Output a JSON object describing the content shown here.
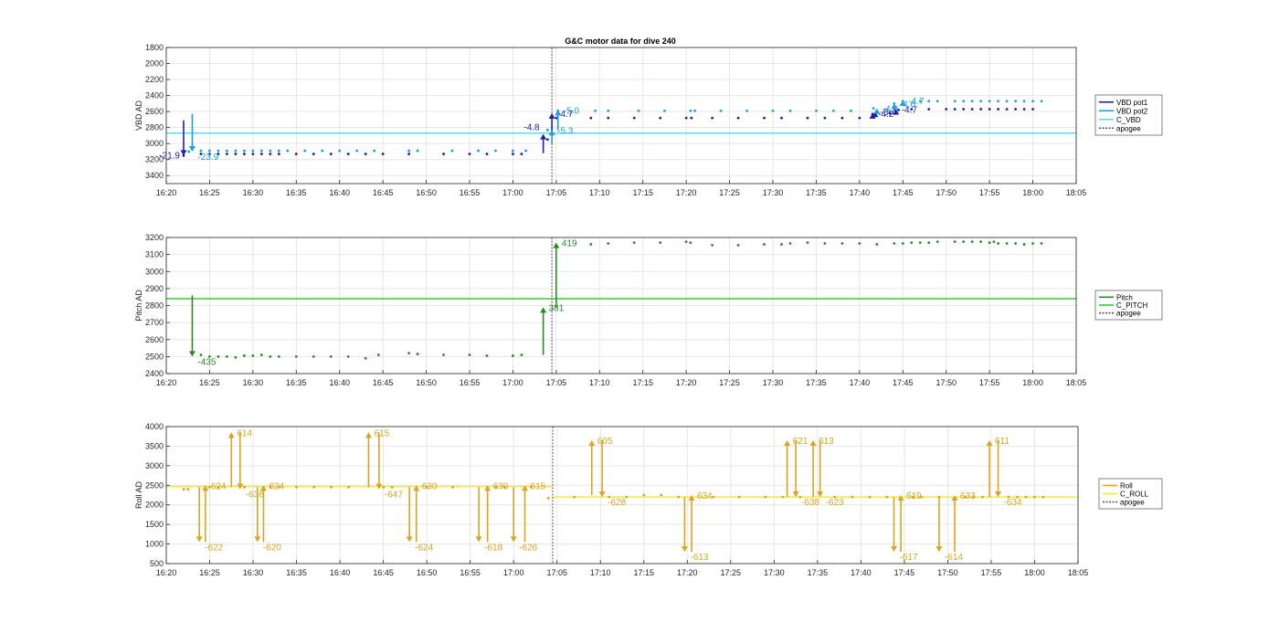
{
  "figure_title": "G&C motor data for dive 240",
  "colors": {
    "vbd_pot1": "#1f1fa8",
    "vbd_pot2": "#1a9fe0",
    "c_vbd": "#5fd8f0",
    "pitch": "#2a8a2a",
    "c_pitch": "#33cc33",
    "roll": "#d9a520",
    "c_roll": "#f5e642",
    "apogee": "#555555",
    "grid": "#e6e6e6",
    "axis": "#262626"
  },
  "chart_data": [
    {
      "type": "scatter",
      "title": "G&C motor data for dive 240",
      "ylabel": "VBD AD",
      "xlabel": "",
      "y_reversed": true,
      "ylim": [
        1800,
        3500
      ],
      "yticks": [
        1800,
        2000,
        2200,
        2400,
        2600,
        2800,
        3000,
        3200,
        3400
      ],
      "xlim": [
        "16:20",
        "18:05"
      ],
      "xticks": [
        "16:20",
        "16:25",
        "16:30",
        "16:35",
        "16:40",
        "16:45",
        "16:50",
        "16:55",
        "17:00",
        "17:05",
        "17:10",
        "17:15",
        "17:20",
        "17:25",
        "17:30",
        "17:35",
        "17:40",
        "17:45",
        "17:50",
        "17:55",
        "18:00",
        "18:05"
      ],
      "grid": true,
      "legend": {
        "position": "right",
        "entries": [
          "VBD pot1",
          "VBD pot2",
          "C_VBD",
          "apogee"
        ]
      },
      "apogee": "17:04.5",
      "reference_lines": [
        {
          "name": "C_VBD",
          "y": 2870
        }
      ],
      "series": [
        {
          "name": "VBD pot1",
          "x": [
            "16:22",
            "16:24",
            "16:25",
            "16:26",
            "16:27",
            "16:28",
            "16:29",
            "16:30",
            "16:31",
            "16:32",
            "16:33",
            "16:35",
            "16:37",
            "16:39",
            "16:41",
            "16:43",
            "16:45",
            "16:48",
            "16:52",
            "16:55",
            "16:57",
            "17:00",
            "17:01",
            "17:04",
            "17:05",
            "17:09",
            "17:11",
            "17:14",
            "17:17",
            "17:20",
            "17:20.6",
            "17:23",
            "17:26",
            "17:29",
            "17:31",
            "17:34",
            "17:36",
            "17:38",
            "17:40",
            "17:41.5",
            "17:43.5",
            "17:44.5",
            "17:46",
            "17:48",
            "17:50",
            "17:51",
            "17:52",
            "17:53",
            "17:54",
            "17:55",
            "17:56",
            "17:57",
            "17:58",
            "17:59",
            "18:00"
          ],
          "y": [
            3150,
            3130,
            3130,
            3130,
            3130,
            3130,
            3130,
            3130,
            3130,
            3130,
            3130,
            3130,
            3130,
            3130,
            3130,
            3130,
            3130,
            3130,
            3130,
            3130,
            3130,
            3130,
            3130,
            2950,
            2680,
            2680,
            2680,
            2680,
            2680,
            2680,
            2680,
            2680,
            2680,
            2680,
            2680,
            2680,
            2680,
            2680,
            2680,
            2630,
            2620,
            2580,
            2570,
            2570,
            2570,
            2570,
            2570,
            2570,
            2570,
            2570,
            2570,
            2570,
            2570,
            2570,
            2570
          ]
        },
        {
          "name": "VBD pot2",
          "x": [
            "16:22.6",
            "16:24",
            "16:25",
            "16:26",
            "16:27",
            "16:28",
            "16:29",
            "16:30",
            "16:31",
            "16:32",
            "16:33",
            "16:34",
            "16:36",
            "16:38",
            "16:40",
            "16:42",
            "16:44",
            "16:48",
            "16:49",
            "16:53",
            "16:56",
            "16:58",
            "17:00",
            "17:01.5",
            "17:04",
            "17:05.2",
            "17:09.5",
            "17:11",
            "17:14.5",
            "17:17.5",
            "17:20.5",
            "17:21",
            "17:24",
            "17:27",
            "17:30",
            "17:32",
            "17:35",
            "17:37",
            "17:39",
            "17:41.6",
            "17:44",
            "17:45",
            "17:47",
            "17:48",
            "17:49",
            "17:51",
            "17:52",
            "17:53",
            "17:54",
            "17:55",
            "17:56",
            "17:57",
            "17:58",
            "17:59",
            "18:00",
            "18:01"
          ],
          "y": [
            3100,
            3090,
            3090,
            3090,
            3090,
            3090,
            3090,
            3090,
            3090,
            3090,
            3090,
            3090,
            3090,
            3090,
            3090,
            3090,
            3090,
            3090,
            3090,
            3090,
            3090,
            3090,
            3090,
            3090,
            2830,
            2590,
            2590,
            2590,
            2590,
            2590,
            2590,
            2590,
            2590,
            2590,
            2590,
            2590,
            2590,
            2590,
            2590,
            2560,
            2500,
            2470,
            2470,
            2470,
            2470,
            2470,
            2470,
            2470,
            2470,
            2470,
            2470,
            2470,
            2470,
            2470,
            2470,
            2470
          ]
        }
      ],
      "annotations": [
        {
          "label": "-21.9",
          "series": "VBD pot1",
          "x": "16:22",
          "from": 2710,
          "to": 3150
        },
        {
          "label": "-23.9",
          "series": "VBD pot2",
          "x": "16:23",
          "from": 2630,
          "to": 3100
        },
        {
          "label": "-4.8",
          "series": "VBD pot1",
          "x": "17:03.5",
          "from": 3120,
          "to": 2880
        },
        {
          "label": "-4.7",
          "series": "VBD pot1",
          "x": "17:04.5",
          "from": 2880,
          "to": 2620
        },
        {
          "label": "-5.3",
          "series": "VBD pot2",
          "x": "17:04.5",
          "from": 3000,
          "to": 2830
        },
        {
          "label": "-5.0",
          "series": "VBD pot2",
          "x": "17:05.2",
          "from": 2830,
          "to": 2580
        },
        {
          "label": "-4.2",
          "series": "VBD pot1",
          "x": "17:41.5",
          "from": 2680,
          "to": 2620
        },
        {
          "label": "-3.4",
          "series": "VBD pot1",
          "x": "17:41.8",
          "from": 2650,
          "to": 2600
        },
        {
          "label": "-4.0",
          "series": "VBD pot2",
          "x": "17:42",
          "from": 2620,
          "to": 2560
        },
        {
          "label": "-4.6",
          "series": "VBD pot2",
          "x": "17:44",
          "from": 2560,
          "to": 2500
        },
        {
          "label": "-4.7",
          "series": "VBD pot2",
          "x": "17:45",
          "from": 2530,
          "to": 2460
        },
        {
          "label": "-4.7",
          "series": "VBD pot1",
          "x": "17:44.2",
          "from": 2620,
          "to": 2570
        }
      ]
    },
    {
      "type": "scatter",
      "title": "",
      "ylabel": "Pitch AD",
      "xlabel": "",
      "ylim": [
        2400,
        3200
      ],
      "yticks": [
        2400,
        2500,
        2600,
        2700,
        2800,
        2900,
        3000,
        3100,
        3200
      ],
      "xlim": [
        "16:20",
        "18:05"
      ],
      "xticks": [
        "16:20",
        "16:25",
        "16:30",
        "16:35",
        "16:40",
        "16:45",
        "16:50",
        "16:55",
        "17:00",
        "17:05",
        "17:10",
        "17:15",
        "17:20",
        "17:25",
        "17:30",
        "17:35",
        "17:40",
        "17:45",
        "17:50",
        "17:55",
        "18:00",
        "18:05"
      ],
      "grid": true,
      "legend": {
        "position": "right",
        "entries": [
          "Pitch",
          "C_PITCH",
          "apogee"
        ]
      },
      "apogee": "17:04.5",
      "reference_lines": [
        {
          "name": "C_PITCH",
          "y": 2840
        }
      ],
      "series": [
        {
          "name": "Pitch",
          "x": [
            "16:24",
            "16:25",
            "16:26",
            "16:27",
            "16:28",
            "16:29",
            "16:30",
            "16:31",
            "16:32",
            "16:33",
            "16:35",
            "16:37",
            "16:39",
            "16:41",
            "16:43",
            "16:44.5",
            "16:48",
            "16:49",
            "16:52",
            "16:55",
            "16:57",
            "17:00",
            "17:01",
            "17:09",
            "17:11",
            "17:14",
            "17:17",
            "17:20",
            "17:20.5",
            "17:23",
            "17:26",
            "17:29",
            "17:31",
            "17:32",
            "17:34",
            "17:36",
            "17:38",
            "17:40",
            "17:42",
            "17:44",
            "17:45",
            "17:46",
            "17:47",
            "17:48",
            "17:49",
            "17:51",
            "17:52",
            "17:53",
            "17:54",
            "17:55",
            "17:55.5",
            "17:56",
            "17:57",
            "17:58",
            "17:59",
            "18:00",
            "18:01"
          ],
          "y": [
            2510,
            2500,
            2500,
            2500,
            2495,
            2505,
            2505,
            2510,
            2500,
            2500,
            2500,
            2500,
            2500,
            2500,
            2490,
            2510,
            2520,
            2515,
            2510,
            2510,
            2505,
            2505,
            2510,
            3160,
            3165,
            3170,
            3170,
            3175,
            3170,
            3155,
            3155,
            3160,
            3160,
            3165,
            3170,
            3165,
            3165,
            3165,
            3160,
            3165,
            3165,
            3170,
            3170,
            3170,
            3175,
            3175,
            3175,
            3175,
            3175,
            3170,
            3175,
            3165,
            3165,
            3165,
            3160,
            3165,
            3165
          ]
        }
      ],
      "annotations": [
        {
          "label": "-435",
          "x": "16:23",
          "from": 2860,
          "to": 2500
        },
        {
          "label": "381",
          "x": "17:03.5",
          "from": 2510,
          "to": 2790
        },
        {
          "label": "419",
          "x": "17:05",
          "from": 2790,
          "to": 3170
        }
      ]
    },
    {
      "type": "scatter",
      "title": "",
      "ylabel": "Roll AD",
      "xlabel": "",
      "ylim": [
        500,
        4000
      ],
      "yticks": [
        500,
        1000,
        1500,
        2000,
        2500,
        3000,
        3500,
        4000
      ],
      "xlim": [
        "16:20",
        "18:05"
      ],
      "xticks": [
        "16:20",
        "16:25",
        "16:30",
        "16:35",
        "16:40",
        "16:45",
        "16:50",
        "16:55",
        "17:00",
        "17:05",
        "17:10",
        "17:15",
        "17:20",
        "17:25",
        "17:30",
        "17:35",
        "17:40",
        "17:45",
        "17:50",
        "17:55",
        "18:00",
        "18:05"
      ],
      "grid": true,
      "legend": {
        "position": "right",
        "entries": [
          "Roll",
          "C_ROLL",
          "apogee"
        ]
      },
      "apogee": "17:04.5",
      "reference_lines": [
        {
          "name": "C_ROLL",
          "y": 2470,
          "x_range": [
            "16:20",
            "17:04.5"
          ]
        },
        {
          "name": "C_ROLL",
          "y": 2200,
          "x_range": [
            "17:04.5",
            "18:05"
          ]
        }
      ],
      "series": [
        {
          "name": "Roll",
          "x": [
            "16:22",
            "16:22.5",
            "16:25",
            "16:26",
            "16:29",
            "16:32",
            "16:33",
            "16:35",
            "16:37",
            "16:39",
            "16:41",
            "16:45",
            "16:46",
            "16:50",
            "16:53",
            "16:58",
            "16:59",
            "17:02",
            "17:04",
            "17:07",
            "17:11",
            "17:13",
            "17:15",
            "17:17",
            "17:19",
            "17:23",
            "17:26",
            "17:29",
            "17:31",
            "17:33",
            "17:37",
            "17:39",
            "17:41",
            "17:43",
            "17:46",
            "17:47",
            "17:49",
            "17:52",
            "17:53",
            "17:54",
            "17:57",
            "17:58",
            "17:59",
            "18:00",
            "18:01"
          ],
          "y": [
            2400,
            2400,
            2450,
            2450,
            2450,
            2450,
            2450,
            2450,
            2450,
            2450,
            2450,
            2450,
            2450,
            2450,
            2450,
            2450,
            2450,
            2450,
            2170,
            2200,
            2200,
            2200,
            2250,
            2250,
            2200,
            2200,
            2200,
            2200,
            2200,
            2200,
            2200,
            2200,
            2200,
            2200,
            2200,
            2200,
            2200,
            2200,
            2200,
            2200,
            2200,
            2200,
            2200,
            2200,
            2200
          ]
        }
      ],
      "annotations": [
        {
          "label": "-622",
          "x": "16:23.8",
          "from": 2450,
          "to": 1050
        },
        {
          "label": "624",
          "x": "16:24.5",
          "from": 1050,
          "to": 2500
        },
        {
          "label": "614",
          "x": "16:27.5",
          "from": 2450,
          "to": 3850
        },
        {
          "label": "-636",
          "x": "16:28.5",
          "from": 3850,
          "to": 2400
        },
        {
          "label": "-620",
          "x": "16:30.5",
          "from": 2450,
          "to": 1050
        },
        {
          "label": "624",
          "x": "16:31.2",
          "from": 1050,
          "to": 2500
        },
        {
          "label": "615",
          "x": "16:43.3",
          "from": 2450,
          "to": 3850
        },
        {
          "label": "-647",
          "x": "16:44.5",
          "from": 3850,
          "to": 2400
        },
        {
          "label": "-624",
          "x": "16:48",
          "from": 2450,
          "to": 1050
        },
        {
          "label": "630",
          "x": "16:48.8",
          "from": 1050,
          "to": 2500
        },
        {
          "label": "-618",
          "x": "16:56",
          "from": 2450,
          "to": 1050
        },
        {
          "label": "630",
          "x": "16:57",
          "from": 1050,
          "to": 2500
        },
        {
          "label": "-626",
          "x": "17:00",
          "from": 2450,
          "to": 1050
        },
        {
          "label": "615",
          "x": "17:01.3",
          "from": 1050,
          "to": 2500
        },
        {
          "label": "605",
          "x": "17:09",
          "from": 2250,
          "to": 3650
        },
        {
          "label": "-628",
          "x": "17:10.2",
          "from": 3650,
          "to": 2200
        },
        {
          "label": "-613",
          "x": "17:19.7",
          "from": 2200,
          "to": 800
        },
        {
          "label": "634",
          "x": "17:20.5",
          "from": 800,
          "to": 2250
        },
        {
          "label": "621",
          "x": "17:31.5",
          "from": 2200,
          "to": 3650
        },
        {
          "label": "-638",
          "x": "17:32.5",
          "from": 3650,
          "to": 2200
        },
        {
          "label": "613",
          "x": "17:34.5",
          "from": 2200,
          "to": 3650
        },
        {
          "label": "-623",
          "x": "17:35.3",
          "from": 3650,
          "to": 2200
        },
        {
          "label": "-617",
          "x": "17:43.8",
          "from": 2200,
          "to": 800
        },
        {
          "label": "619",
          "x": "17:44.6",
          "from": 800,
          "to": 2250
        },
        {
          "label": "-614",
          "x": "17:49",
          "from": 2200,
          "to": 800
        },
        {
          "label": "633",
          "x": "17:50.8",
          "from": 800,
          "to": 2250
        },
        {
          "label": "611",
          "x": "17:54.8",
          "from": 2200,
          "to": 3650
        },
        {
          "label": "-634",
          "x": "17:55.8",
          "from": 3650,
          "to": 2200
        }
      ]
    }
  ]
}
